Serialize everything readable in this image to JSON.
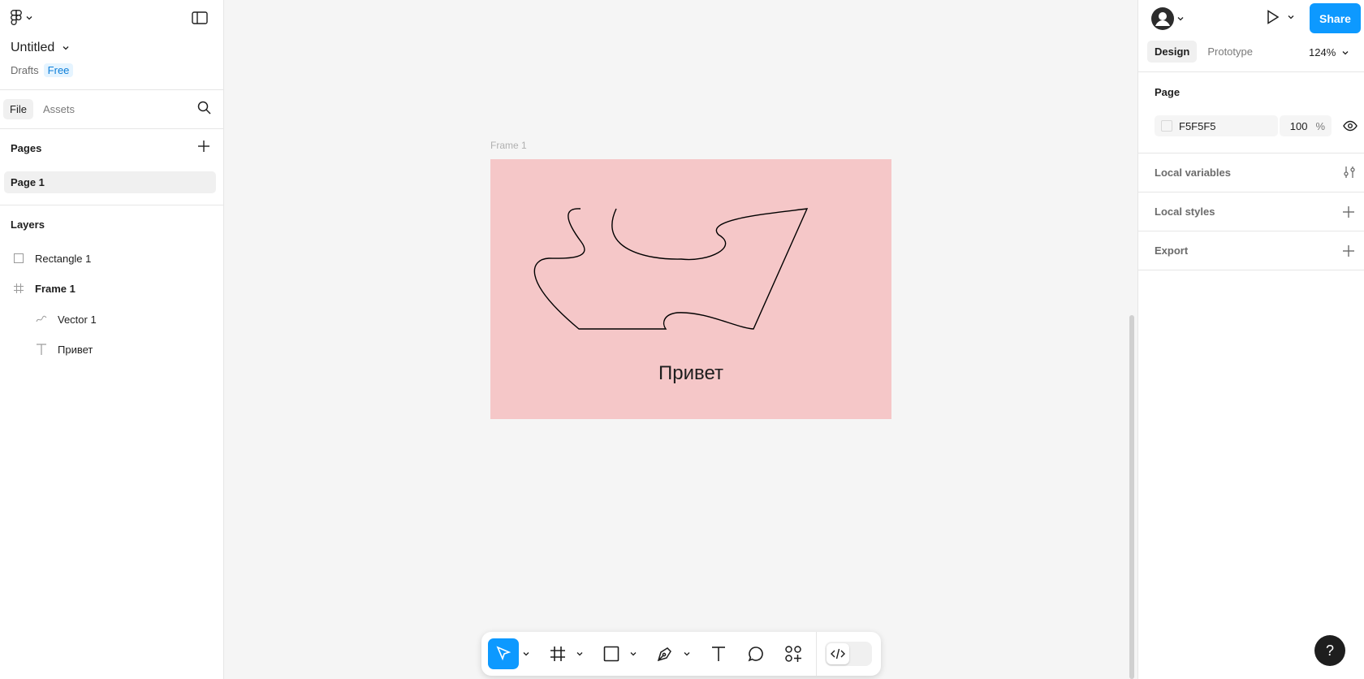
{
  "file": {
    "title": "Untitled",
    "location": "Drafts",
    "plan_badge": "Free"
  },
  "left_tabs": [
    "File",
    "Assets"
  ],
  "pages": {
    "title": "Pages",
    "items": [
      "Page 1"
    ]
  },
  "layers": {
    "title": "Layers",
    "items": [
      {
        "name": "Rectangle 1",
        "icon": "rectangle-icon"
      },
      {
        "name": "Frame 1",
        "icon": "frame-icon"
      },
      {
        "name": "Vector 1",
        "icon": "vector-icon"
      },
      {
        "name": "Привет",
        "icon": "text-icon"
      }
    ]
  },
  "canvas": {
    "frame_label": "Frame 1",
    "frame_text": "Привет",
    "frame_color": "#F5C7C8"
  },
  "right": {
    "share_label": "Share",
    "tabs": [
      "Design",
      "Prototype"
    ],
    "zoom": "124%",
    "page_section": "Page",
    "page_color": "F5F5F5",
    "page_opacity": "100",
    "opacity_unit": "%",
    "local_variables": "Local variables",
    "local_styles": "Local styles",
    "export": "Export"
  },
  "help_label": "?",
  "colors": {
    "accent": "#0D99FF",
    "canvas_bg": "#F5F5F5"
  }
}
